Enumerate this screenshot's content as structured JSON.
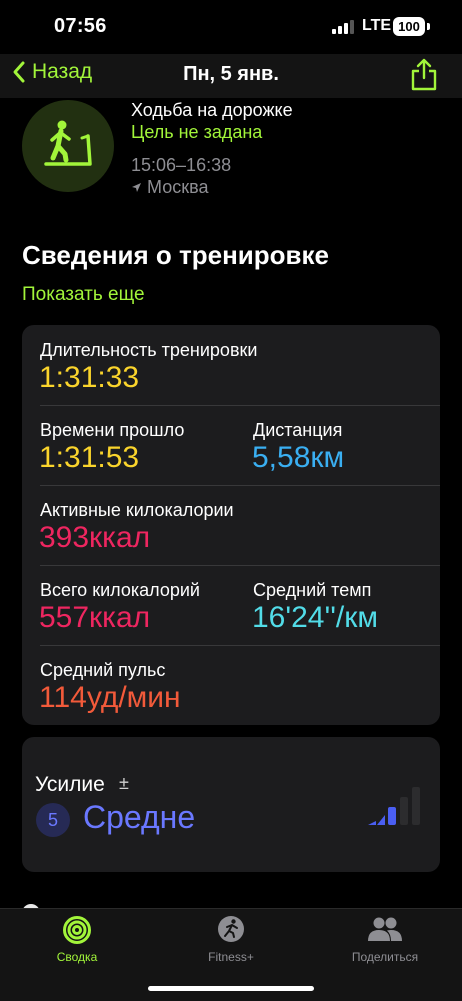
{
  "status": {
    "time": "07:56",
    "network": "LTE",
    "battery": "100"
  },
  "nav": {
    "back_label": "Назад",
    "title": "Пн, 5 янв."
  },
  "workout": {
    "name": "Ходьба на дорожке",
    "goal": "Цель не задана",
    "time_range": "15:06–16:38",
    "location": "Москва"
  },
  "section": {
    "title": "Сведения о тренировке",
    "show_more": "Показать еще"
  },
  "metrics": {
    "duration": {
      "label": "Длительность тренировки",
      "value": "1:31:33"
    },
    "elapsed": {
      "label": "Времени прошло",
      "value": "1:31:53"
    },
    "distance": {
      "label": "Дистанция",
      "value": "5,58км"
    },
    "active_kcal": {
      "label": "Активные килокалории",
      "value": "393ккал"
    },
    "total_kcal": {
      "label": "Всего килокалорий",
      "value": "557ккал"
    },
    "avg_pace": {
      "label": "Средний темп",
      "value": "16'24''/км"
    },
    "avg_hr": {
      "label": "Средний пульс",
      "value": "114уд/мин"
    }
  },
  "effort": {
    "label": "Усилие",
    "adjust_symbol": "±",
    "level": "5",
    "level_text": "Средне"
  },
  "tabs": [
    {
      "label": "Сводка",
      "icon": "activity-rings-icon",
      "active": true
    },
    {
      "label": "Fitness+",
      "icon": "fitness-plus-icon",
      "active": false
    },
    {
      "label": "Поделиться",
      "icon": "sharing-people-icon",
      "active": false
    }
  ],
  "colors": {
    "accent": "#a2f53a",
    "yellow": "#fad42c",
    "blue": "#3aaff2",
    "red": "#ee2660",
    "cyan": "#52dce8",
    "orange": "#f25a3a",
    "effort": "#6a78ff"
  }
}
